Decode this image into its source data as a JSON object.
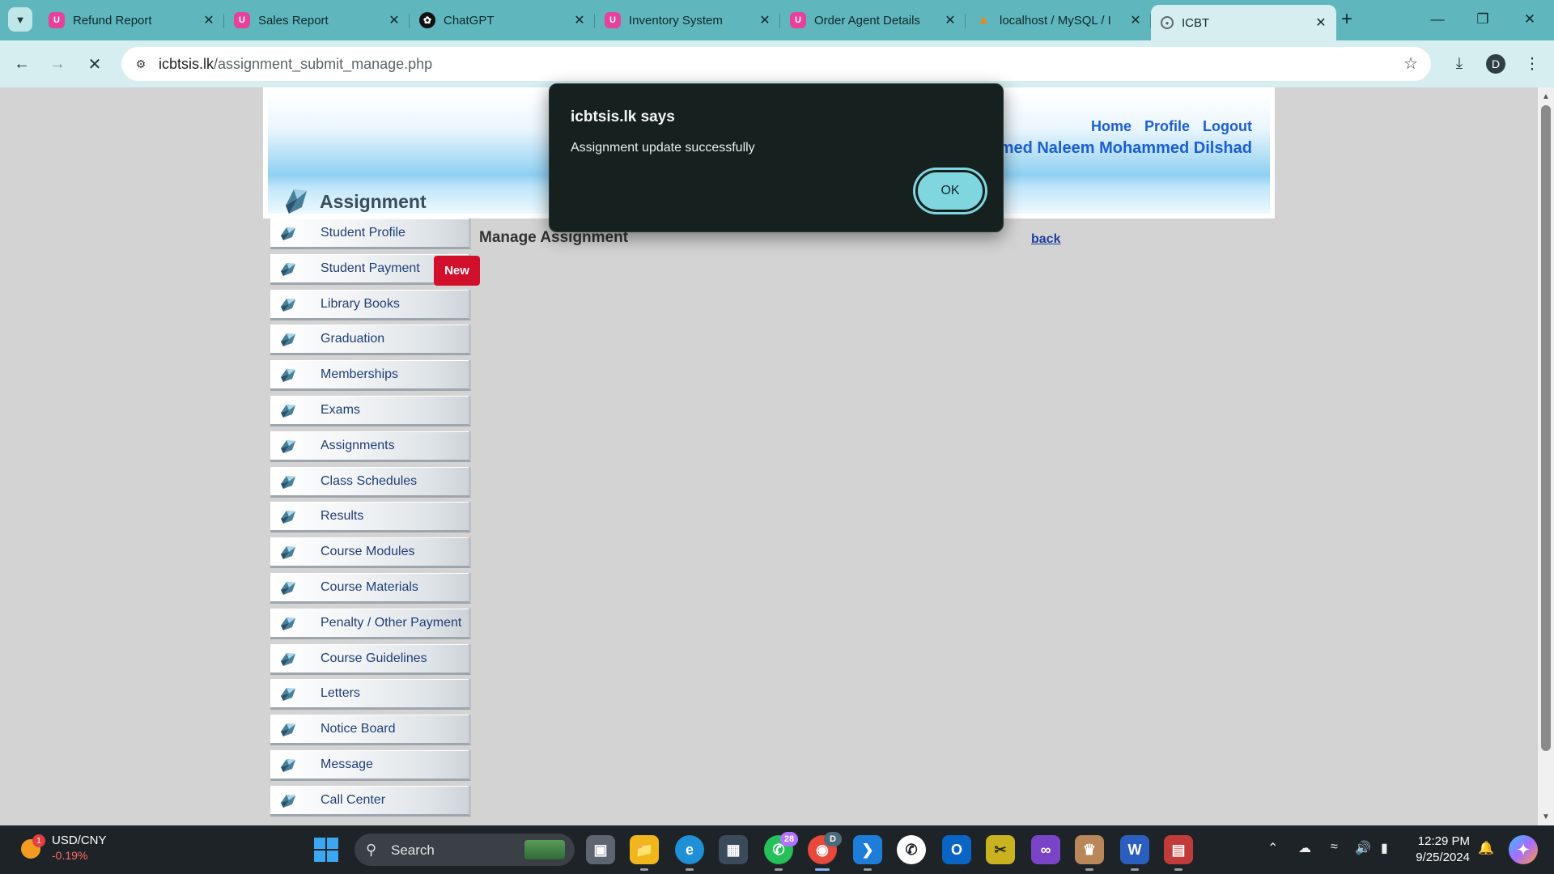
{
  "browser": {
    "tabs": [
      {
        "title": "Refund Report",
        "icon": "app-pink-icon",
        "active": false
      },
      {
        "title": "Sales Report",
        "icon": "app-pink-icon",
        "active": false
      },
      {
        "title": "ChatGPT",
        "icon": "chatgpt-icon",
        "active": false
      },
      {
        "title": "Inventory System",
        "icon": "app-pink-icon",
        "active": false
      },
      {
        "title": "Order Agent Details",
        "icon": "app-pink-icon",
        "active": false
      },
      {
        "title": "localhost / MySQL / I",
        "icon": "phpmyadmin-icon",
        "active": false
      },
      {
        "title": "ICBT",
        "icon": "icbt-icon",
        "active": true
      }
    ],
    "url_host": "icbtsis.lk",
    "url_path": "/assignment_submit_manage.php",
    "profile_initial": "D",
    "colors": {
      "tabstrip": "#5fb6bd",
      "toolbar": "#d6eef0"
    }
  },
  "header": {
    "section_title": "Assignment",
    "links": {
      "home": "Home",
      "profile": "Profile",
      "logout": "Logout"
    },
    "user_name": "med Naleem Mohammed Dilshad"
  },
  "sidebar": {
    "items": [
      {
        "label": "Student Profile"
      },
      {
        "label": "Student Payment"
      },
      {
        "label": "Library Books"
      },
      {
        "label": "Graduation"
      },
      {
        "label": "Memberships"
      },
      {
        "label": "Exams"
      },
      {
        "label": "Assignments"
      },
      {
        "label": "Class Schedules"
      },
      {
        "label": "Results"
      },
      {
        "label": "Course Modules"
      },
      {
        "label": "Course Materials"
      },
      {
        "label": "Penalty / Other Payment"
      },
      {
        "label": "Course Guidelines"
      },
      {
        "label": "Letters"
      },
      {
        "label": "Notice Board"
      },
      {
        "label": "Message"
      },
      {
        "label": "Call Center"
      }
    ],
    "new_badge": "New"
  },
  "main": {
    "title": "Manage Assignment",
    "back_label": "back"
  },
  "dialog": {
    "title": "icbtsis.lk says",
    "message": "Assignment update successfully",
    "ok_label": "OK"
  },
  "taskbar": {
    "ticker_name": "USD/CNY",
    "ticker_change": "-0.19%",
    "weather_badge": "1",
    "search_label": "Search",
    "whatsapp_badge": "28",
    "chrome_badge": "D",
    "time": "12:29 PM",
    "date": "9/25/2024"
  }
}
